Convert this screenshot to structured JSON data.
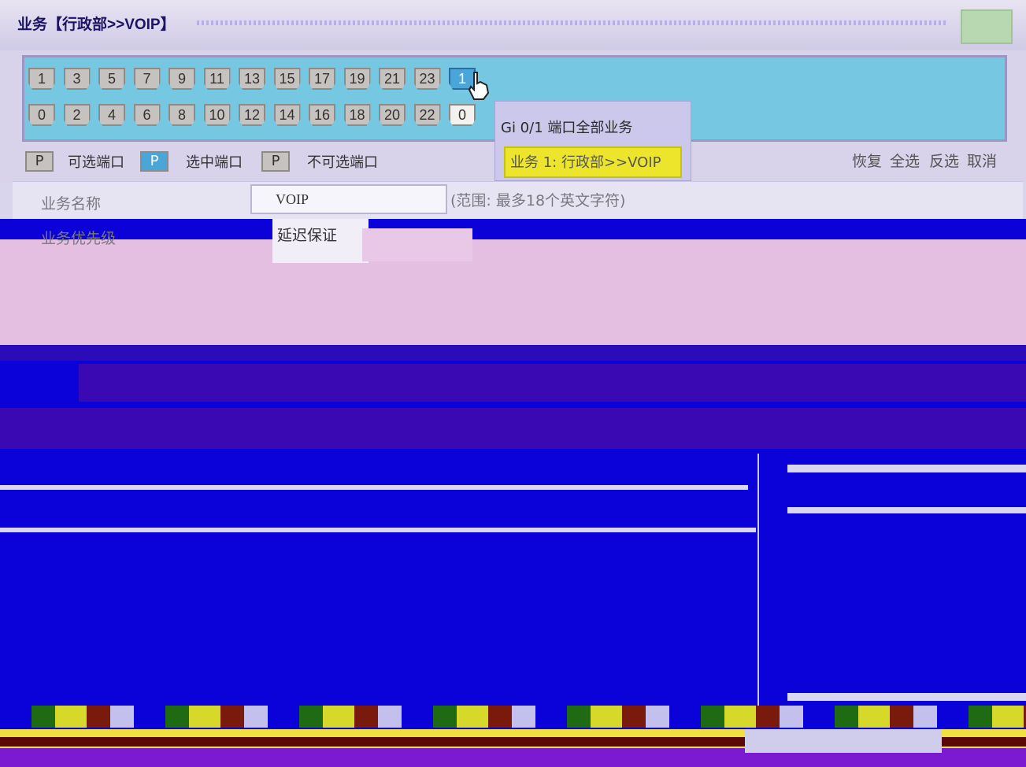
{
  "title": "业务【行政部>>VOIP】",
  "ports": {
    "top_row": [
      "1",
      "3",
      "5",
      "7",
      "9",
      "11",
      "13",
      "15",
      "17",
      "19",
      "21",
      "23",
      "1"
    ],
    "bottom_row": [
      "0",
      "2",
      "4",
      "6",
      "8",
      "10",
      "12",
      "14",
      "16",
      "18",
      "20",
      "22",
      "0"
    ]
  },
  "tooltip": {
    "title": "Gi 0/1 端口全部业务",
    "item": "业务 1: 行政部>>VOIP"
  },
  "legend": {
    "selectable": "可选端口",
    "selected": "选中端口",
    "unselectable": "不可选端口",
    "chip": "P"
  },
  "actions": {
    "restore": "恢复",
    "select_all": "全选",
    "invert": "反选",
    "cancel": "取消"
  },
  "form": {
    "name_label": "业务名称",
    "name_value": "VOIP",
    "name_hint": "(范围: 最多18个英文字符)",
    "priority_label": "业务优先级",
    "priority_value": "延迟保证"
  },
  "colors": {
    "port_panel": "#76c8e2",
    "selected_port": "#4aa6d8",
    "tooltip_highlight": "#ece52c"
  }
}
